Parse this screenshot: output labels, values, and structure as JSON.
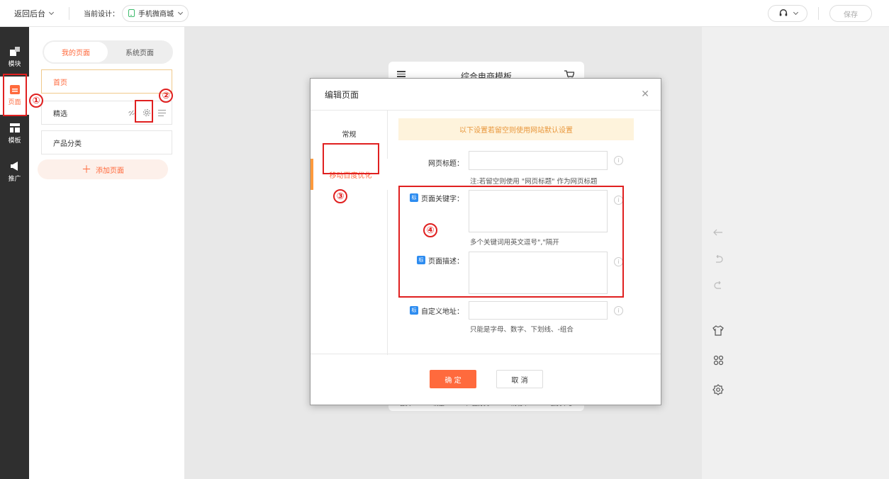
{
  "topbar": {
    "back_label": "返回后台",
    "current_label": "当前设计：",
    "design_name": "手机微商城",
    "save_label": "保存"
  },
  "rail": {
    "items": [
      {
        "label": "模块"
      },
      {
        "label": "页面"
      },
      {
        "label": "模板"
      },
      {
        "label": "推广"
      }
    ]
  },
  "panel": {
    "tabs": [
      "我的页面",
      "系统页面"
    ],
    "pages": [
      "首页",
      "精选",
      "产品分类"
    ],
    "add_page_label": "添加页面"
  },
  "phone": {
    "title": "综合电商模板",
    "bottom_nav": [
      "首页",
      "精选",
      "产品分类",
      "购物车",
      "会员中心"
    ]
  },
  "modal": {
    "title": "编辑页面",
    "tabs": [
      "常规",
      "移动百度优化"
    ],
    "notice": "以下设置若留空则使用网站默认设置",
    "fields": {
      "page_title_label": "网页标题：",
      "page_title_hint": "注:若留空则使用 \"网页标题\" 作为网页标题",
      "keywords_label": "页面关键字：",
      "keywords_hint": "多个关键词用英文逗号\",\"隔开",
      "description_label": "页面描述：",
      "custom_url_label": "自定义地址：",
      "custom_url_hint": "只能是字母、数字、下划线、-组合",
      "tag_glyph": "标",
      "info_glyph": "i"
    },
    "ok_label": "确 定",
    "cancel_label": "取 消"
  },
  "annotations": {
    "marks": [
      "①",
      "②",
      "③",
      "④"
    ],
    "color": "#e02020"
  },
  "colors": {
    "accent": "#ff6a3d",
    "rail_bg": "#2f2f2f",
    "notice_bg": "#fef3dc",
    "tag_blue": "#2d8cf0"
  }
}
